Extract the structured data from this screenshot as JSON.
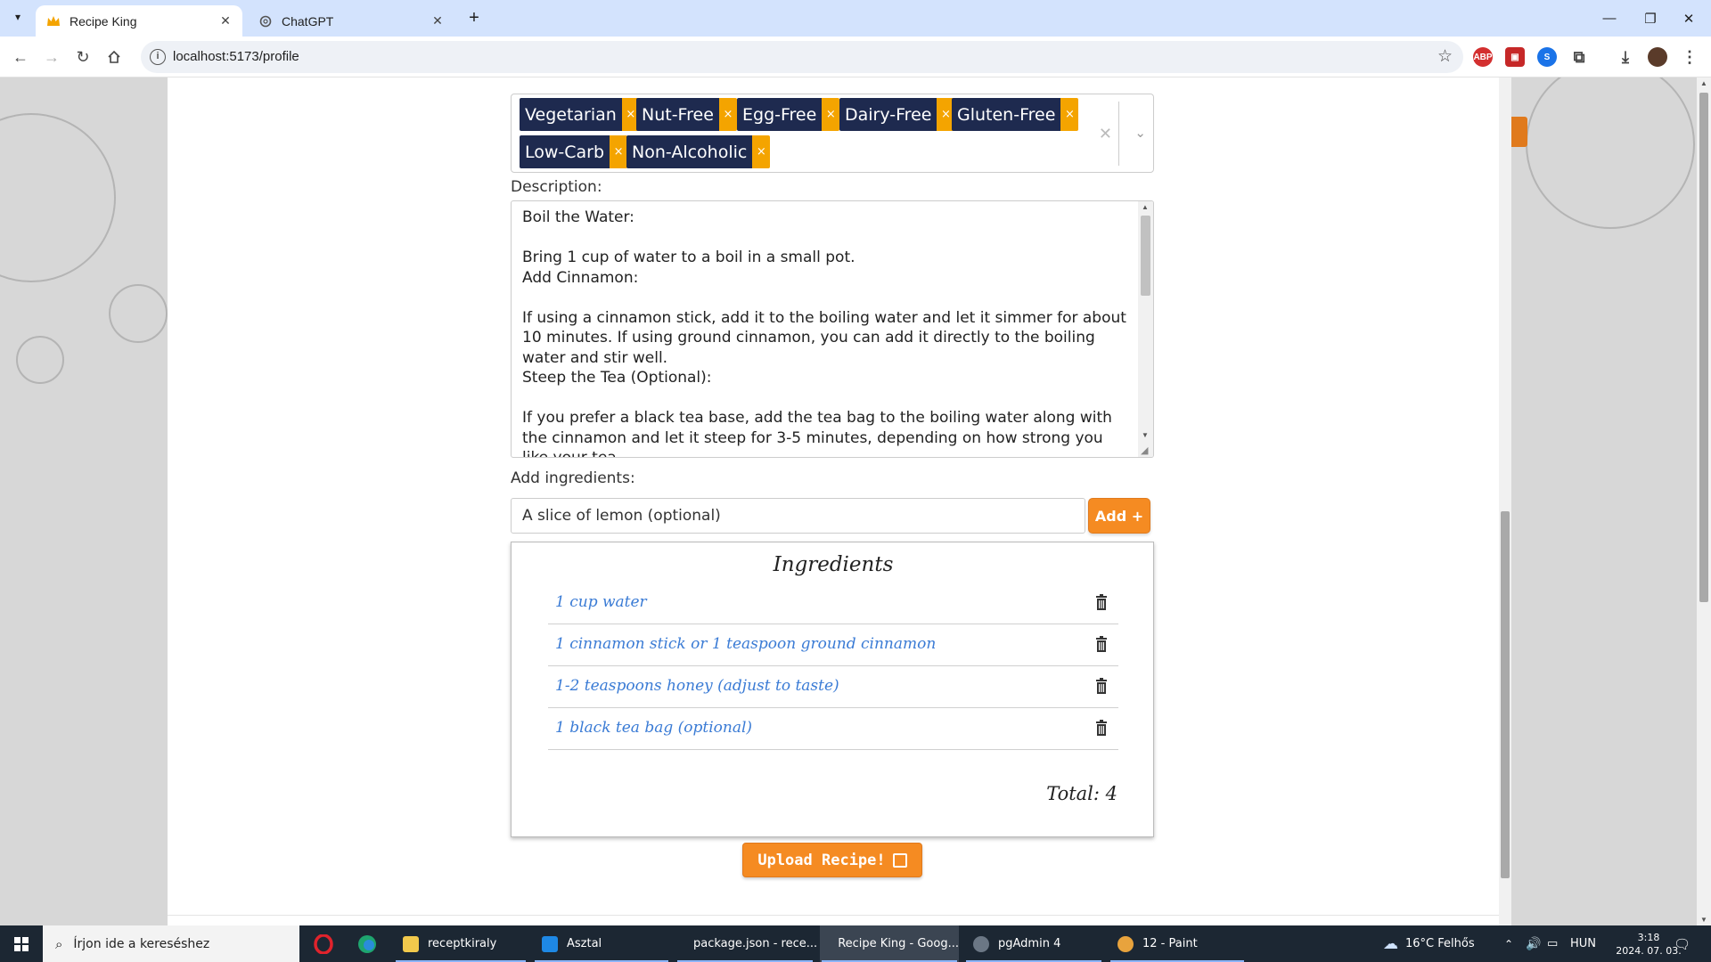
{
  "browser": {
    "tabs": [
      {
        "title": "Recipe King",
        "active": true
      },
      {
        "title": "ChatGPT",
        "active": false
      }
    ],
    "url": "localhost:5173/profile"
  },
  "form": {
    "tags": [
      "Vegetarian",
      "Nut-Free",
      "Egg-Free",
      "Dairy-Free",
      "Gluten-Free",
      "Low-Carb",
      "Non-Alcoholic"
    ],
    "tag_remove_glyph": "×",
    "description_label": "Description:",
    "description_text": "Boil the Water:\n\nBring 1 cup of water to a boil in a small pot.\nAdd Cinnamon:\n\nIf using a cinnamon stick, add it to the boiling water and let it simmer for about 10 minutes. If using ground cinnamon, you can add it directly to the boiling water and stir well.\nSteep the Tea (Optional):\n\nIf you prefer a black tea base, add the tea bag to the boiling water along with the cinnamon and let it steep for 3-5 minutes, depending on how strong you like your tea.",
    "ingredients_label": "Add ingredients:",
    "ingredient_input_value": "A slice of lemon (optional)",
    "add_button": "Add +",
    "ingredients_title": "Ingredients",
    "ingredients": [
      "1 cup water",
      "1 cinnamon stick or 1 teaspoon ground cinnamon",
      "1-2 teaspoons honey (adjust to taste)",
      "1 black tea bag (optional)"
    ],
    "total_text": "Total: 4",
    "upload_button": "Upload Recipe!"
  },
  "taskbar": {
    "search_placeholder": "Írjon ide a kereséshez",
    "apps": [
      "receptkiraly",
      "Asztal",
      "package.json - rece...",
      "Recipe King - Goog...",
      "pgAdmin 4",
      "12 - Paint"
    ],
    "weather": "16°C  Felhős",
    "language": "HUN",
    "time": "3:18",
    "date": "2024. 07. 03."
  },
  "colors": {
    "tag_bg": "#1e2a4f",
    "tag_remove_bg": "#f4a400",
    "accent_orange": "#f58b22",
    "ingredient_text": "#3a7bd5"
  }
}
